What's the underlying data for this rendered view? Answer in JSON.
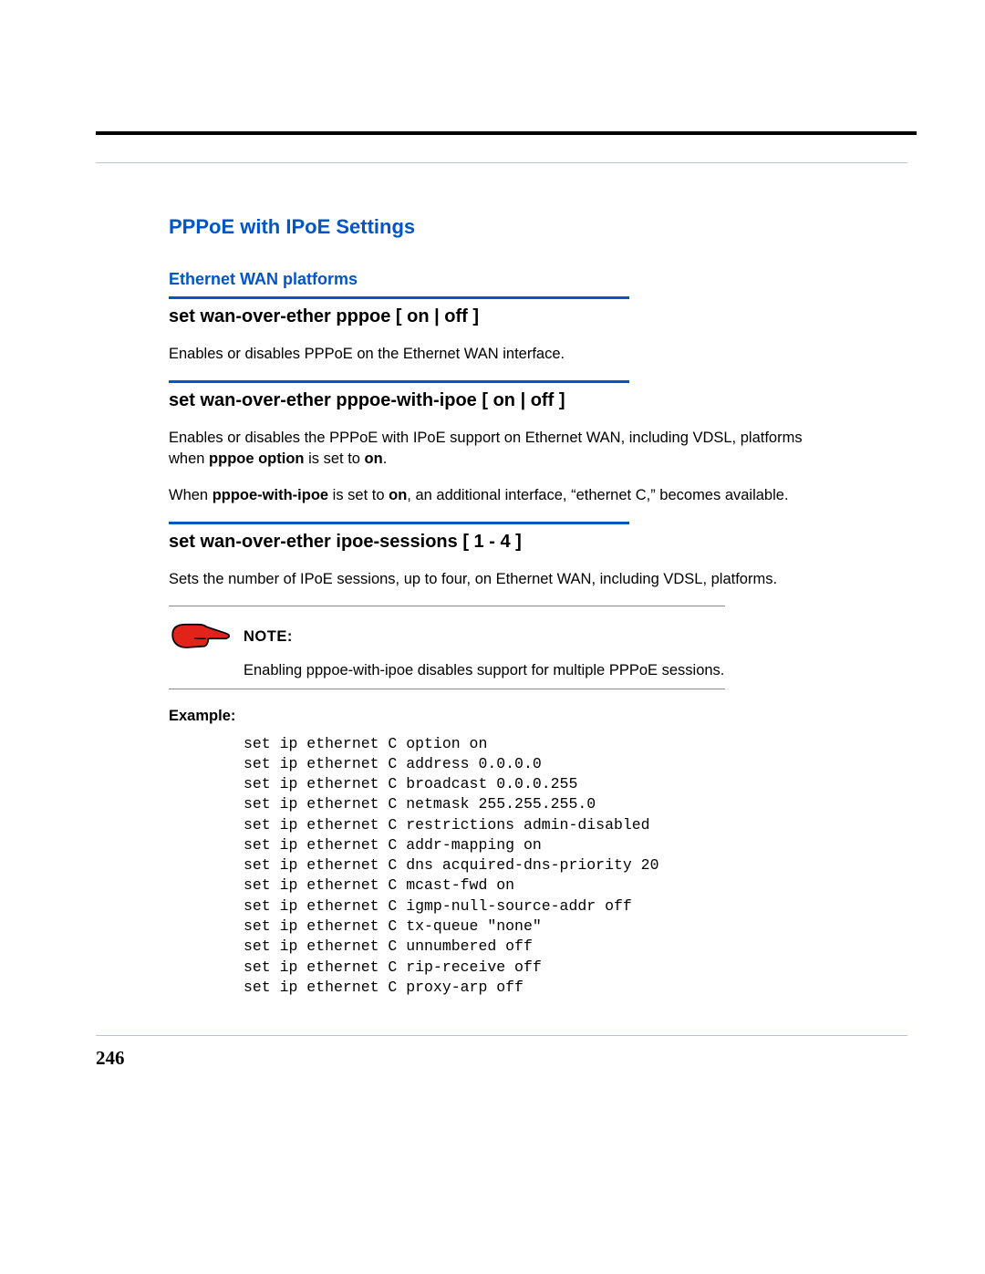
{
  "page_number": "246",
  "section_title": "PPPoE with IPoE Settings",
  "subsection_title": "Ethernet WAN platforms",
  "commands": [
    {
      "heading": "set wan-over-ether pppoe [ on | off ]",
      "paragraphs": [
        {
          "html": "Enables or disables PPPoE on the Ethernet WAN interface."
        }
      ]
    },
    {
      "heading": "set wan-over-ether pppoe-with-ipoe [ on | off ]",
      "paragraphs": [
        {
          "html": "Enables or disables the PPPoE with IPoE support on Ethernet WAN, including VDSL, platforms when <span class=\"b\">pppoe option</span> is set to <span class=\"b\">on</span>."
        },
        {
          "html": "When <span class=\"b\">pppoe-with-ipoe</span> is set to <span class=\"b\">on</span>, an additional interface, “ethernet C,” becomes available."
        }
      ]
    },
    {
      "heading": "set wan-over-ether ipoe-sessions [ 1 - 4 ]",
      "paragraphs": [
        {
          "html": "Sets the number of IPoE sessions, up to four, on Ethernet WAN, including VDSL, platforms."
        }
      ]
    }
  ],
  "note": {
    "label": "NOTE:",
    "text": "Enabling pppoe-with-ipoe disables support for multiple PPPoE sessions."
  },
  "example": {
    "label": "Example:",
    "code": "set ip ethernet C option on\nset ip ethernet C address 0.0.0.0\nset ip ethernet C broadcast 0.0.0.255\nset ip ethernet C netmask 255.255.255.0\nset ip ethernet C restrictions admin-disabled\nset ip ethernet C addr-mapping on\nset ip ethernet C dns acquired-dns-priority 20\nset ip ethernet C mcast-fwd on\nset ip ethernet C igmp-null-source-addr off\nset ip ethernet C tx-queue \"none\"\nset ip ethernet C unnumbered off\nset ip ethernet C rip-receive off\nset ip ethernet C proxy-arp off"
  }
}
